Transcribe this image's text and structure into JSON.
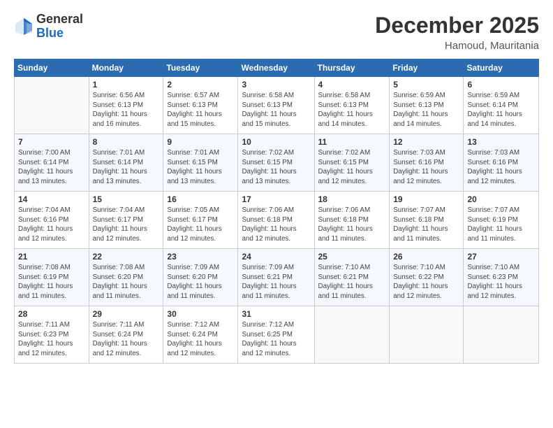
{
  "header": {
    "logo_line1": "General",
    "logo_line2": "Blue",
    "month": "December 2025",
    "location": "Hamoud, Mauritania"
  },
  "weekdays": [
    "Sunday",
    "Monday",
    "Tuesday",
    "Wednesday",
    "Thursday",
    "Friday",
    "Saturday"
  ],
  "weeks": [
    [
      {
        "num": "",
        "info": ""
      },
      {
        "num": "1",
        "info": "Sunrise: 6:56 AM\nSunset: 6:13 PM\nDaylight: 11 hours\nand 16 minutes."
      },
      {
        "num": "2",
        "info": "Sunrise: 6:57 AM\nSunset: 6:13 PM\nDaylight: 11 hours\nand 15 minutes."
      },
      {
        "num": "3",
        "info": "Sunrise: 6:58 AM\nSunset: 6:13 PM\nDaylight: 11 hours\nand 15 minutes."
      },
      {
        "num": "4",
        "info": "Sunrise: 6:58 AM\nSunset: 6:13 PM\nDaylight: 11 hours\nand 14 minutes."
      },
      {
        "num": "5",
        "info": "Sunrise: 6:59 AM\nSunset: 6:13 PM\nDaylight: 11 hours\nand 14 minutes."
      },
      {
        "num": "6",
        "info": "Sunrise: 6:59 AM\nSunset: 6:14 PM\nDaylight: 11 hours\nand 14 minutes."
      }
    ],
    [
      {
        "num": "7",
        "info": "Sunrise: 7:00 AM\nSunset: 6:14 PM\nDaylight: 11 hours\nand 13 minutes."
      },
      {
        "num": "8",
        "info": "Sunrise: 7:01 AM\nSunset: 6:14 PM\nDaylight: 11 hours\nand 13 minutes."
      },
      {
        "num": "9",
        "info": "Sunrise: 7:01 AM\nSunset: 6:15 PM\nDaylight: 11 hours\nand 13 minutes."
      },
      {
        "num": "10",
        "info": "Sunrise: 7:02 AM\nSunset: 6:15 PM\nDaylight: 11 hours\nand 13 minutes."
      },
      {
        "num": "11",
        "info": "Sunrise: 7:02 AM\nSunset: 6:15 PM\nDaylight: 11 hours\nand 12 minutes."
      },
      {
        "num": "12",
        "info": "Sunrise: 7:03 AM\nSunset: 6:16 PM\nDaylight: 11 hours\nand 12 minutes."
      },
      {
        "num": "13",
        "info": "Sunrise: 7:03 AM\nSunset: 6:16 PM\nDaylight: 11 hours\nand 12 minutes."
      }
    ],
    [
      {
        "num": "14",
        "info": "Sunrise: 7:04 AM\nSunset: 6:16 PM\nDaylight: 11 hours\nand 12 minutes."
      },
      {
        "num": "15",
        "info": "Sunrise: 7:04 AM\nSunset: 6:17 PM\nDaylight: 11 hours\nand 12 minutes."
      },
      {
        "num": "16",
        "info": "Sunrise: 7:05 AM\nSunset: 6:17 PM\nDaylight: 11 hours\nand 12 minutes."
      },
      {
        "num": "17",
        "info": "Sunrise: 7:06 AM\nSunset: 6:18 PM\nDaylight: 11 hours\nand 12 minutes."
      },
      {
        "num": "18",
        "info": "Sunrise: 7:06 AM\nSunset: 6:18 PM\nDaylight: 11 hours\nand 11 minutes."
      },
      {
        "num": "19",
        "info": "Sunrise: 7:07 AM\nSunset: 6:18 PM\nDaylight: 11 hours\nand 11 minutes."
      },
      {
        "num": "20",
        "info": "Sunrise: 7:07 AM\nSunset: 6:19 PM\nDaylight: 11 hours\nand 11 minutes."
      }
    ],
    [
      {
        "num": "21",
        "info": "Sunrise: 7:08 AM\nSunset: 6:19 PM\nDaylight: 11 hours\nand 11 minutes."
      },
      {
        "num": "22",
        "info": "Sunrise: 7:08 AM\nSunset: 6:20 PM\nDaylight: 11 hours\nand 11 minutes."
      },
      {
        "num": "23",
        "info": "Sunrise: 7:09 AM\nSunset: 6:20 PM\nDaylight: 11 hours\nand 11 minutes."
      },
      {
        "num": "24",
        "info": "Sunrise: 7:09 AM\nSunset: 6:21 PM\nDaylight: 11 hours\nand 11 minutes."
      },
      {
        "num": "25",
        "info": "Sunrise: 7:10 AM\nSunset: 6:21 PM\nDaylight: 11 hours\nand 11 minutes."
      },
      {
        "num": "26",
        "info": "Sunrise: 7:10 AM\nSunset: 6:22 PM\nDaylight: 11 hours\nand 12 minutes."
      },
      {
        "num": "27",
        "info": "Sunrise: 7:10 AM\nSunset: 6:23 PM\nDaylight: 11 hours\nand 12 minutes."
      }
    ],
    [
      {
        "num": "28",
        "info": "Sunrise: 7:11 AM\nSunset: 6:23 PM\nDaylight: 11 hours\nand 12 minutes."
      },
      {
        "num": "29",
        "info": "Sunrise: 7:11 AM\nSunset: 6:24 PM\nDaylight: 11 hours\nand 12 minutes."
      },
      {
        "num": "30",
        "info": "Sunrise: 7:12 AM\nSunset: 6:24 PM\nDaylight: 11 hours\nand 12 minutes."
      },
      {
        "num": "31",
        "info": "Sunrise: 7:12 AM\nSunset: 6:25 PM\nDaylight: 11 hours\nand 12 minutes."
      },
      {
        "num": "",
        "info": ""
      },
      {
        "num": "",
        "info": ""
      },
      {
        "num": "",
        "info": ""
      }
    ]
  ]
}
